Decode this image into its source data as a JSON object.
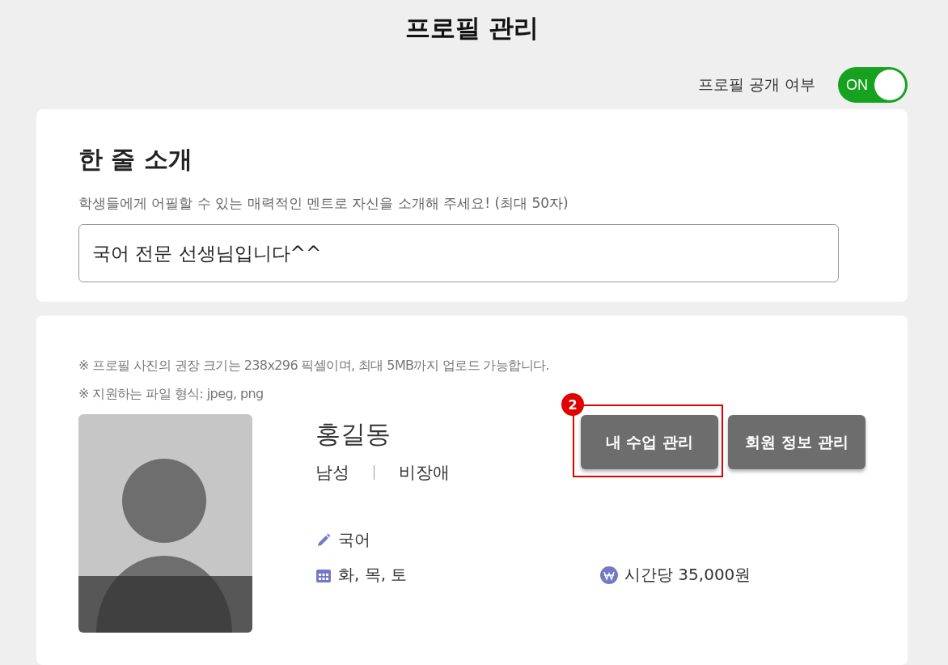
{
  "page_title": "프로필 관리",
  "visibility": {
    "label": "프로필 공개 여부",
    "on": true,
    "on_text": "ON"
  },
  "intro": {
    "title": "한 줄 소개",
    "hint": "학생들에게 어필할 수 있는 매력적인 멘트로 자신을 소개해 주세요! (최대 50자)",
    "value": "국어 전문 선생님입니다^^"
  },
  "profile": {
    "notes": [
      "※ 프로필 사진의 권장 크기는 238x296 픽셀이며, 최대 5MB까지 업로드 가능합니다.",
      "※ 지원하는 파일 형식: jpeg, png"
    ],
    "name": "홍길동",
    "gender": "남성",
    "disability": "비장애",
    "buttons": [
      {
        "label": "내 수업 관리",
        "annotation": "2"
      },
      {
        "label": "회원 정보 관리"
      }
    ],
    "subject": "국어",
    "days": "화, 목, 토",
    "price": "시간당 35,000원"
  }
}
